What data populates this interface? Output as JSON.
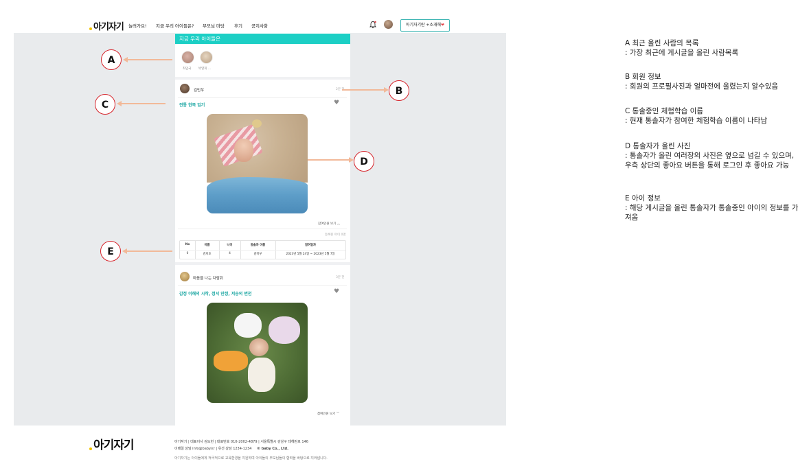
{
  "header": {
    "logo": "아기자기",
    "nav": [
      "놀러가요!",
      "지금 우리 아이들은?",
      "부모님 마당",
      "후기",
      "공지사항"
    ],
    "join_button": "아기자기란 +소개해",
    "join_heart": "❤"
  },
  "feed": {
    "banner_title": "지금 우리 아이들은",
    "recent_users": [
      {
        "name": "최민국"
      },
      {
        "name": "박영희 ..."
      }
    ],
    "posts": [
      {
        "author": "김민우",
        "time": "2분 전",
        "topic": "전통 한복 입기",
        "photo": "beach",
        "more_label": "참여인원 보기",
        "table_caption": "등록된 아이 0명",
        "table_headers": [
          "No",
          "이름",
          "나이",
          "동솔자 이름",
          "참여일자"
        ],
        "table_rows": [
          [
            "0",
            "김지호",
            "4",
            "김미우",
            "2023년 5월 24일 ~ 2023년 5월 7일"
          ]
        ]
      },
      {
        "author": "마음을 나는 다람쥐",
        "time": "3분 전",
        "topic": "감정 이해의 시작, 정서 안정, 저승의 변천",
        "photo": "grass",
        "more_label": "참여인원 보기"
      }
    ]
  },
  "annotations": {
    "labels": [
      "A",
      "B",
      "C",
      "D",
      "E"
    ],
    "notes": [
      {
        "title": "A 최근 올린 사람의 목록",
        "body": ": 가장 최근에 게시글을 올린 사람목록"
      },
      {
        "title": "B 회원 정보",
        "body": ": 회원의 프로필사진과 얼마전에 올렸는지 알수있음"
      },
      {
        "title": "C 통솔중인 체험학습 이름",
        "body": ": 현재 통솔자가 참여한 체험학습 이름이 나타남"
      },
      {
        "title": "D 통솔자가 올린 사진",
        "body": ": 통솔자가 올린 여러장의 사진은 옆으로 넘길 수 있으며, 우측 상단의 좋아요 버튼을 통해 로그인 후 좋아요 가능"
      },
      {
        "title": "E 아이 정보",
        "body": ": 해당 게시글을 올린 통솔자가 통솔중인 아이의 정보를 가져옴"
      }
    ]
  },
  "footer": {
    "logo": "아기자기",
    "line1": "아기자기  |  대표이사 김도현  |  대표번호 010-2002-4879  |  서울특별시 강남구 테헤란로 146",
    "line2_prefix": "이메일 상담 info@baby.kr  |  유선 상담 1234-1234",
    "line2_copy": "© baby Co., Ltd.",
    "line3": "아기자기는 아이들에게 적극적으로 교육환경을 지원하며 아이들의 부모님들의 협력을 바탕으로 지켜냅니다."
  },
  "colors": {
    "accent": "#1ccfc5",
    "annotation_red": "#d6232a",
    "arrow": "#f2b999",
    "background_gray": "#e9ebed"
  }
}
